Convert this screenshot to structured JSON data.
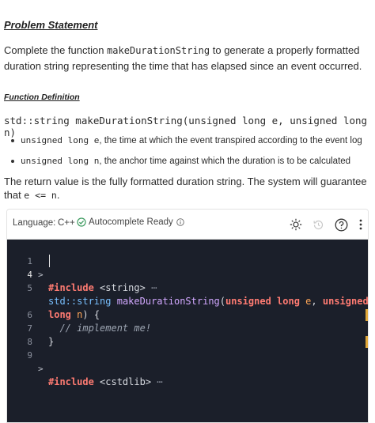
{
  "problem": {
    "title": "Problem Statement",
    "intro_a": "Complete the function ",
    "intro_fn": "makeDurationString",
    "intro_b": " to generate a properly formatted duration string representing the time that has elapsed since an event occurred."
  },
  "function_definition": {
    "title": "Function Definition",
    "signature": "std::string makeDurationString(unsigned long e, unsigned long n)",
    "params": [
      {
        "code": "unsigned long e",
        "text": ", the time at which the event transpired according to the event log"
      },
      {
        "code": "unsigned long n",
        "text": ", the anchor time against which the duration is to be calculated"
      }
    ],
    "return_a": "The return value is the fully formatted duration string. The system will guarantee that ",
    "return_code": "e <= n",
    "return_b": "."
  },
  "toolbar": {
    "language_label": "Language:",
    "language_value": "C++",
    "autocomplete_label": "Autocomplete Ready",
    "icons": [
      "settings-sun-icon",
      "history-icon",
      "help-icon",
      "more-icon"
    ]
  },
  "code": {
    "line_numbers": [
      "1",
      "4",
      "5",
      "",
      "6",
      "7",
      "8",
      "9"
    ],
    "include_kw": "#include",
    "include_1": "<string>",
    "include_2": "<cstdlib>",
    "ellipsis": "⋯",
    "std_string": "std::string",
    "fn_name": "makeDurationString",
    "open_paren": "(",
    "unsigned": "unsigned",
    "long": "long",
    "param_e": "e",
    "comma": ",",
    "param_n": "n",
    "close_brace_open": ") {",
    "comment": "// implement me!",
    "close_brace": "}"
  },
  "colors": {
    "editor_bg": "#1b1f2a",
    "keyword": "#ff7b72",
    "type": "#79c0ff",
    "function": "#d2a8ff",
    "param": "#ffa657",
    "gutter_marker": "#e2a93b",
    "check_green": "#3c9a5f"
  }
}
